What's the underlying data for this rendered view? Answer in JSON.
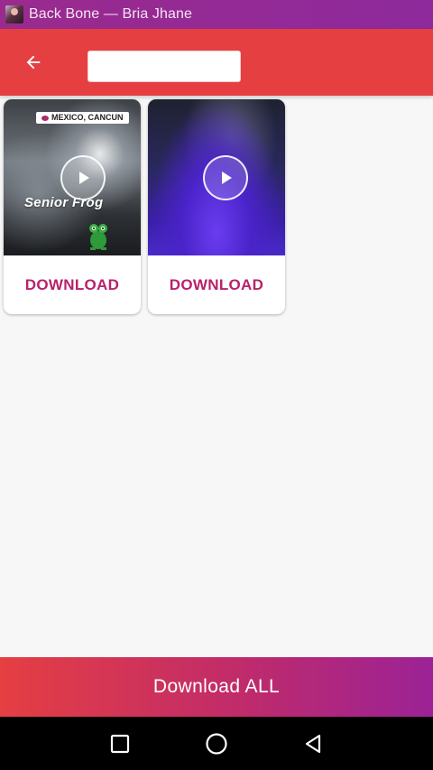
{
  "status_bar": {
    "title": "Back Bone — Bria Jhane",
    "avatar_icon": "album-art-thumbnail"
  },
  "app_bar": {
    "back_icon": "arrow-left-icon",
    "search": {
      "value": "",
      "placeholder": ""
    },
    "color": "#e53f42"
  },
  "media": [
    {
      "location_tag": "MEXICO, CANCUN",
      "overlay_text": "Senior Frog",
      "play_icon": "play-icon",
      "download_label": "DOWNLOAD"
    },
    {
      "location_tag": "",
      "overlay_text": "",
      "play_icon": "play-icon",
      "download_label": "DOWNLOAD"
    }
  ],
  "footer": {
    "download_all_label": "Download ALL",
    "gradient": [
      "#e53f42",
      "#9b2296"
    ]
  },
  "nav_bar": {
    "icons": [
      "recents-square-icon",
      "home-circle-icon",
      "back-triangle-icon"
    ]
  },
  "accent_color": "#b8216a"
}
